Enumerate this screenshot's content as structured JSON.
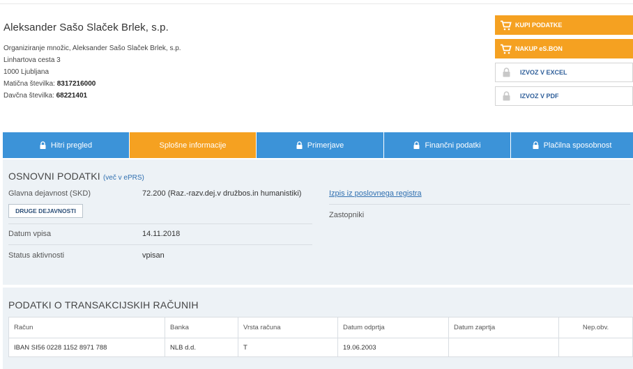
{
  "company": {
    "name": "Aleksander Sašo Slaček Brlek, s.p.",
    "line1": "Organiziranje množic, Aleksander Sašo Slaček Brlek, s.p.",
    "street": "Linhartova cesta 3",
    "city": "1000 Ljubljana",
    "maticna_label": "Matična številka:",
    "maticna_value": "8317216000",
    "davcna_label": "Davčna številka:",
    "davcna_value": "68221401"
  },
  "actions": {
    "kupi": "KUPI PODATKE",
    "nakup": "NAKUP eS.BON",
    "excel": "IZVOZ V EXCEL",
    "pdf": "IZVOZ V PDF"
  },
  "tabs": [
    {
      "label": "Hitri pregled",
      "locked": true
    },
    {
      "label": "Splošne informacije",
      "locked": false,
      "active": true
    },
    {
      "label": "Primerjave",
      "locked": true
    },
    {
      "label": "Finančni podatki",
      "locked": true
    },
    {
      "label": "Plačilna sposobnost",
      "locked": true
    }
  ],
  "basic": {
    "title": "OSNOVNI PODATKI",
    "more": "(več v ePRS)",
    "activity_label": "Glavna dejavnost (SKD)",
    "activity_value": "72.200 (Raz.-razv.dej.v družbos.in humanistiki)",
    "other_btn": "DRUGE DEJAVNOSTI",
    "date_label": "Datum vpisa",
    "date_value": "14.11.2018",
    "status_label": "Status aktivnosti",
    "status_value": "vpisan",
    "registry_link": "Izpis iz poslovnega registra",
    "reps_label": "Zastopniki"
  },
  "accounts": {
    "title": "PODATKI O TRANSAKCIJSKIH RAČUNIH",
    "headers": [
      "Račun",
      "Banka",
      "Vrsta računa",
      "Datum odprtja",
      "Datum zaprtja",
      "Nep.obv."
    ],
    "rows": [
      [
        "IBAN SI56 0228 1152 8971 788",
        "NLB d.d.",
        "T",
        "19.06.2003",
        "",
        ""
      ]
    ]
  },
  "colors": {
    "accent_orange": "#f5a121",
    "tab_blue": "#3c93d8",
    "section_bg": "#edf2f6",
    "link_blue": "#2f6fb0"
  },
  "icons": {
    "cart": "cart-icon",
    "lock": "lock-icon"
  }
}
